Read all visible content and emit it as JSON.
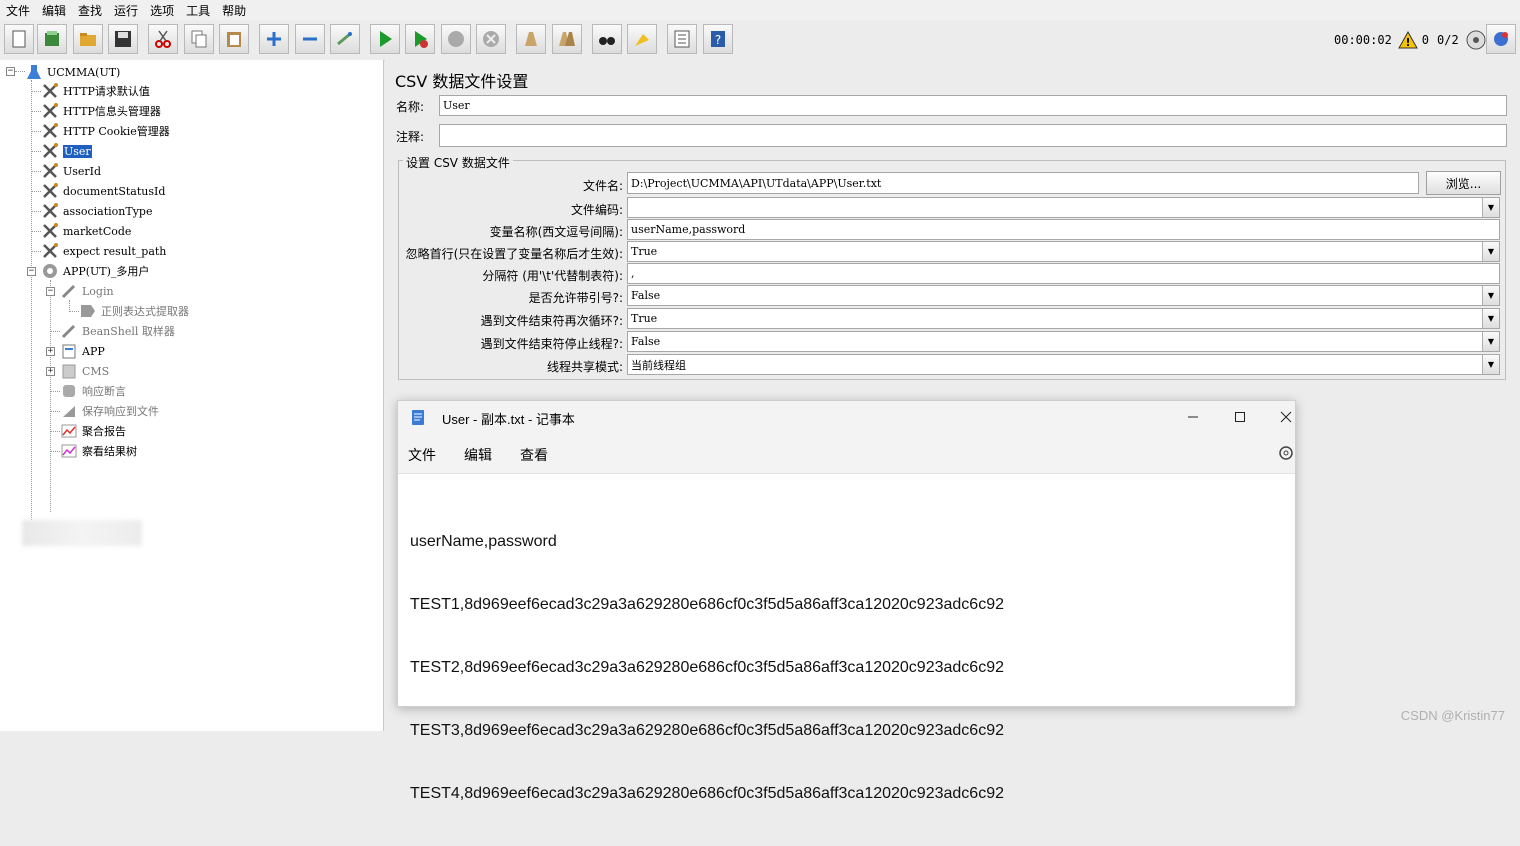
{
  "menu": [
    "文件",
    "编辑",
    "查找",
    "运行",
    "选项",
    "工具",
    "帮助"
  ],
  "toolbar": {
    "buttons": [
      "new-icon",
      "templates-icon",
      "open-icon",
      "save-icon",
      "cut-icon",
      "copy-icon",
      "paste-icon",
      "expand-icon",
      "collapse-icon",
      "toggle-icon",
      "start-icon",
      "start-no-pause-icon",
      "stop-icon",
      "shutdown-icon",
      "clear-icon",
      "clear-all-icon",
      "search-icon",
      "reset-search-icon",
      "function-helper-icon",
      "help-icon"
    ],
    "timer": "00:00:02",
    "warnings": "0",
    "threads": "0/2"
  },
  "tree": {
    "root": "UCMMA(UT)",
    "items": [
      "HTTP请求默认值",
      "HTTP信息头管理器",
      "HTTP Cookie管理器",
      "User",
      "UserId",
      "documentStatusId",
      "associationType",
      "marketCode",
      "expect result_path"
    ],
    "thread_group": "APP(UT)_多用户",
    "children": [
      "Login",
      "正则表达式提取器",
      "BeanShell 取样器",
      "APP",
      "CMS",
      "响应断言",
      "保存响应到文件",
      "聚合报告",
      "察看结果树"
    ]
  },
  "panel": {
    "title": "CSV 数据文件设置",
    "name_label": "名称:",
    "name_value": "User",
    "comment_label": "注释:",
    "comment_value": "",
    "group_title": "设置 CSV 数据文件",
    "fields": [
      {
        "label": "文件名:",
        "value": "D:\\Project\\UCMMA\\API\\UTdata\\APP\\User.txt"
      },
      {
        "label": "文件编码:",
        "value": ""
      },
      {
        "label": "变量名称(西文逗号间隔):",
        "value": "userName,password"
      },
      {
        "label": "忽略首行(只在设置了变量名称后才生效):",
        "value": "True"
      },
      {
        "label": "分隔符 (用'\\t'代替制表符):",
        "value": ","
      },
      {
        "label": "是否允许带引号?:",
        "value": "False"
      },
      {
        "label": "遇到文件结束符再次循环?:",
        "value": "True"
      },
      {
        "label": "遇到文件结束符停止线程?:",
        "value": "False"
      },
      {
        "label": "线程共享模式:",
        "value": "当前线程组"
      }
    ],
    "browse_label": "浏览..."
  },
  "notepad": {
    "title": "User - 副本.txt - 记事本",
    "menu": [
      "文件",
      "编辑",
      "查看"
    ],
    "lines": [
      "userName,password",
      "TEST1,8d969eef6ecad3c29a3a629280e686cf0c3f5d5a86aff3ca12020c923adc6c92",
      "TEST2,8d969eef6ecad3c29a3a629280e686cf0c3f5d5a86aff3ca12020c923adc6c92",
      "TEST3,8d969eef6ecad3c29a3a629280e686cf0c3f5d5a86aff3ca12020c923adc6c92",
      "TEST4,8d969eef6ecad3c29a3a629280e686cf0c3f5d5a86aff3ca12020c923adc6c92"
    ]
  },
  "watermark": "CSDN @Kristin77"
}
